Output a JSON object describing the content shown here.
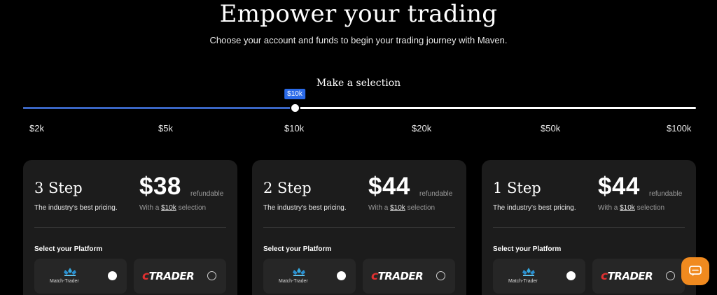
{
  "hero": {
    "title": "Empower your trading",
    "subtitle": "Choose your account and funds to begin your trading journey with Maven."
  },
  "selector": {
    "label": "Make a selection",
    "selected_label": "$10k",
    "selected_index": 2,
    "ticks": [
      "$2k",
      "$5k",
      "$10k",
      "$20k",
      "$50k",
      "$100k"
    ],
    "fill_color": "#3a66c4",
    "tooltip_color": "#2a6ae8"
  },
  "cards": [
    {
      "name": "3 Step",
      "tagline": "The industry's best pricing.",
      "price": "$38",
      "refund": "refundable",
      "with_prefix": "With a",
      "with_selection": "$10k",
      "with_suffix": "selection",
      "platform_label": "Select your Platform",
      "platforms": [
        {
          "name": "Match-Trader",
          "icon": "match-trader-logo",
          "selected": true
        },
        {
          "name": "TRADER",
          "prefix": "c",
          "icon": "ctrader-logo",
          "selected": false
        }
      ]
    },
    {
      "name": "2 Step",
      "tagline": "The industry's best pricing.",
      "price": "$44",
      "refund": "refundable",
      "with_prefix": "With a",
      "with_selection": "$10k",
      "with_suffix": "selection",
      "platform_label": "Select your Platform",
      "platforms": [
        {
          "name": "Match-Trader",
          "icon": "match-trader-logo",
          "selected": true
        },
        {
          "name": "TRADER",
          "prefix": "c",
          "icon": "ctrader-logo",
          "selected": false
        }
      ]
    },
    {
      "name": "1 Step",
      "tagline": "The industry's best pricing.",
      "price": "$44",
      "refund": "refundable",
      "with_prefix": "With a",
      "with_selection": "$10k",
      "with_suffix": "selection",
      "platform_label": "Select your Platform",
      "platforms": [
        {
          "name": "Match-Trader",
          "icon": "match-trader-logo",
          "selected": true
        },
        {
          "name": "TRADER",
          "prefix": "c",
          "icon": "ctrader-logo",
          "selected": false
        }
      ]
    }
  ],
  "chat": {
    "icon": "chat-bubble-icon",
    "color": "#f08a1f"
  }
}
